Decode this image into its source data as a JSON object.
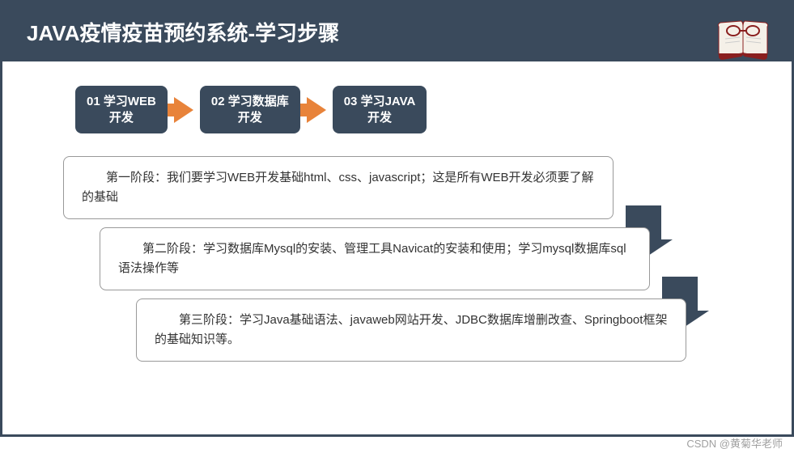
{
  "header": {
    "title": "JAVA疫情疫苗预约系统-学习步骤"
  },
  "steps": [
    {
      "num": "01",
      "line1": "01 学习WEB",
      "line2": "开发"
    },
    {
      "num": "02",
      "line1": "02 学习数据库",
      "line2": "开发"
    },
    {
      "num": "03",
      "line1": "03 学习JAVA",
      "line2": "开发"
    }
  ],
  "phases": {
    "p1": "　　第一阶段：我们要学习WEB开发基础html、css、javascript；这是所有WEB开发必须要了解的基础",
    "p2": "　　第二阶段：学习数据库Mysql的安装、管理工具Navicat的安装和使用；学习mysql数据库sql语法操作等",
    "p3": "　　第三阶段：学习Java基础语法、javaweb网站开发、JDBC数据库增删改查、Springboot框架的基础知识等。"
  },
  "watermark": "CSDN @黄菊华老师"
}
